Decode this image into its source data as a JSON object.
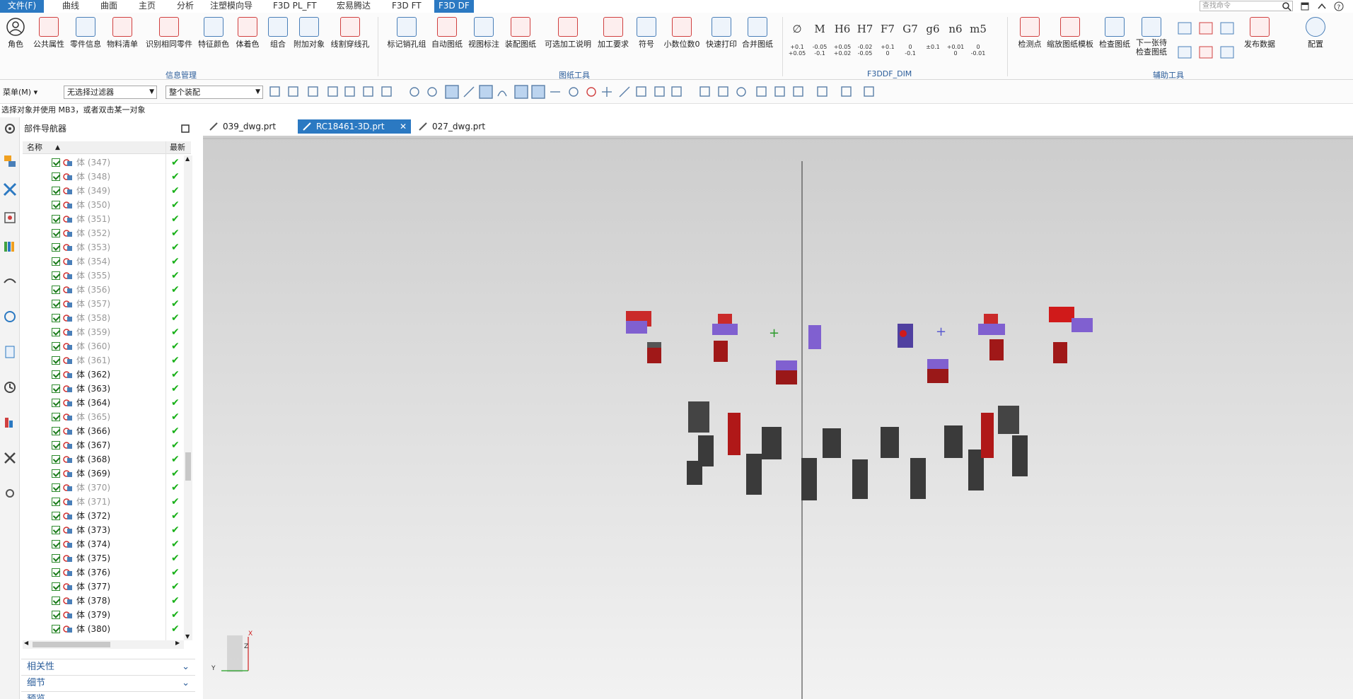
{
  "menubar": {
    "file": "文件(F)",
    "tabs": [
      "曲线",
      "曲面",
      "主页",
      "分析",
      "注塑模向导",
      "F3D PL_FT",
      "宏易腾达",
      "F3D FT",
      "F3D DF"
    ],
    "search_placeholder": "查找命令"
  },
  "ribbon": {
    "info_group": {
      "label": "信息管理",
      "buttons": [
        "角色",
        "公共属性",
        "零件信息",
        "物料清单",
        "识别相同零件",
        "特征颜色",
        "体着色",
        "组合",
        "附加对象",
        "线割穿线孔"
      ]
    },
    "drawing_group": {
      "label": "图纸工具",
      "buttons": [
        "标记销孔组",
        "自动图纸",
        "视图标注",
        "装配图纸",
        "可选加工说明",
        "加工要求",
        "符号",
        "小数位数0",
        "快速打印",
        "合并图纸"
      ]
    },
    "dim_group": {
      "label": "F3DDF_DIM",
      "symbols": [
        "∅",
        "M",
        "H6",
        "H7",
        "F7",
        "G7",
        "g6",
        "n6",
        "m5"
      ],
      "tolerances": [
        "+0.1\n+0.05",
        "-0.05\n-0.1",
        "+0.05\n+0.02",
        "-0.02\n-0.05",
        "+0.1\n0",
        "0\n-0.1",
        "±0.1",
        "+0.01\n0",
        "0\n-0.01"
      ]
    },
    "aux_group": {
      "label": "辅助工具",
      "buttons": [
        "检测点",
        "缩放图纸模板",
        "检查图纸",
        "下一张待\n检查图纸",
        "发布数据",
        "配置"
      ]
    }
  },
  "toolbar2": {
    "menu": "菜单(M)",
    "filter": "无选择过滤器",
    "scope": "整个装配"
  },
  "status": "选择对象并使用 MB3，或者双击某一对象",
  "navigator": {
    "title": "部件导航器",
    "col_name": "名称",
    "col_latest": "最新",
    "rows": [
      {
        "label": "体 (347)",
        "dim": true
      },
      {
        "label": "体 (348)",
        "dim": true
      },
      {
        "label": "体 (349)",
        "dim": true
      },
      {
        "label": "体 (350)",
        "dim": true
      },
      {
        "label": "体 (351)",
        "dim": true
      },
      {
        "label": "体 (352)",
        "dim": true
      },
      {
        "label": "体 (353)",
        "dim": true
      },
      {
        "label": "体 (354)",
        "dim": true
      },
      {
        "label": "体 (355)",
        "dim": true
      },
      {
        "label": "体 (356)",
        "dim": true
      },
      {
        "label": "体 (357)",
        "dim": true
      },
      {
        "label": "体 (358)",
        "dim": true
      },
      {
        "label": "体 (359)",
        "dim": true
      },
      {
        "label": "体 (360)",
        "dim": true
      },
      {
        "label": "体 (361)",
        "dim": true
      },
      {
        "label": "体 (362)",
        "dim": false
      },
      {
        "label": "体 (363)",
        "dim": false
      },
      {
        "label": "体 (364)",
        "dim": false
      },
      {
        "label": "体 (365)",
        "dim": true
      },
      {
        "label": "体 (366)",
        "dim": false
      },
      {
        "label": "体 (367)",
        "dim": false
      },
      {
        "label": "体 (368)",
        "dim": false
      },
      {
        "label": "体 (369)",
        "dim": false
      },
      {
        "label": "体 (370)",
        "dim": true
      },
      {
        "label": "体 (371)",
        "dim": true
      },
      {
        "label": "体 (372)",
        "dim": false
      },
      {
        "label": "体 (373)",
        "dim": false
      },
      {
        "label": "体 (374)",
        "dim": false
      },
      {
        "label": "体 (375)",
        "dim": false
      },
      {
        "label": "体 (376)",
        "dim": false
      },
      {
        "label": "体 (377)",
        "dim": false
      },
      {
        "label": "体 (378)",
        "dim": false
      },
      {
        "label": "体 (379)",
        "dim": false
      },
      {
        "label": "体 (380)",
        "dim": false
      }
    ],
    "accordions": [
      "相关性",
      "细节",
      "预览"
    ]
  },
  "tabs": [
    {
      "label": "039_dwg.prt",
      "active": false
    },
    {
      "label": "RC18461-3D.prt",
      "active": true
    },
    {
      "label": "027_dwg.prt",
      "active": false
    }
  ],
  "axis": {
    "y": "Y",
    "z": "Z",
    "x": "X"
  },
  "colors": {
    "accent": "#2b79c2",
    "check": "#18b018"
  }
}
